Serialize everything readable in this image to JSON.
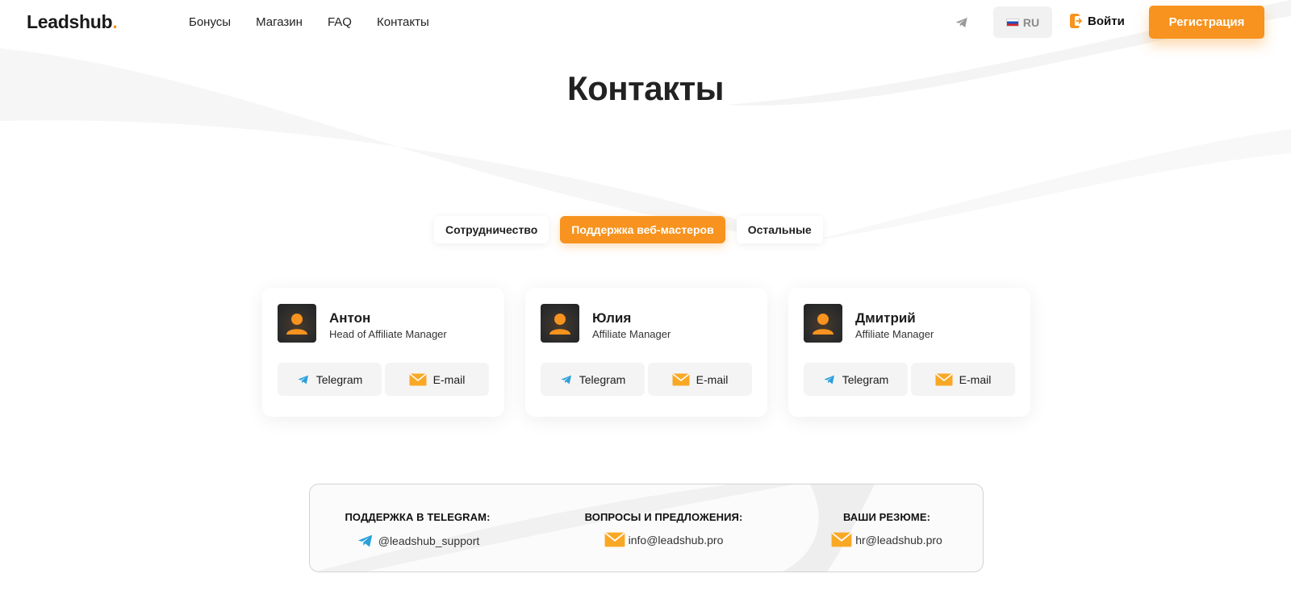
{
  "header": {
    "logo": "Leadshub",
    "logo_dot": ".",
    "nav": [
      "Бонусы",
      "Магазин",
      "FAQ",
      "Контакты"
    ],
    "language": "RU",
    "login_label": "Войти",
    "register_label": "Регистрация"
  },
  "page": {
    "title": "Контакты"
  },
  "tabs": [
    {
      "label": "Сотрудничество",
      "active": false
    },
    {
      "label": "Поддержка веб-мастеров",
      "active": true
    },
    {
      "label": "Остальные",
      "active": false
    }
  ],
  "contacts": [
    {
      "name": "Антон",
      "role": "Head of Affiliate Manager",
      "telegram_label": "Telegram",
      "email_label": "E-mail"
    },
    {
      "name": "Юлия",
      "role": "Affiliate Manager",
      "telegram_label": "Telegram",
      "email_label": "E-mail"
    },
    {
      "name": "Дмитрий",
      "role": "Affiliate Manager",
      "telegram_label": "Telegram",
      "email_label": "E-mail"
    }
  ],
  "footer": {
    "support": {
      "heading": "ПОДДЕРЖКА В TELEGRAM:",
      "value": "@leadshub_support"
    },
    "questions": {
      "heading": "ВОПРОСЫ И ПРЕДЛОЖЕНИЯ:",
      "value": "info@leadshub.pro"
    },
    "resume": {
      "heading": "ВАШИ РЕЗЮМЕ:",
      "value": "hr@leadshub.pro"
    }
  },
  "colors": {
    "accent": "#f7931e",
    "telegram": "#2aa0da",
    "text": "#1c1c1c"
  },
  "icons": {
    "telegram": "telegram-icon",
    "email": "envelope-icon",
    "login": "login-icon",
    "avatar": "person-icon"
  }
}
